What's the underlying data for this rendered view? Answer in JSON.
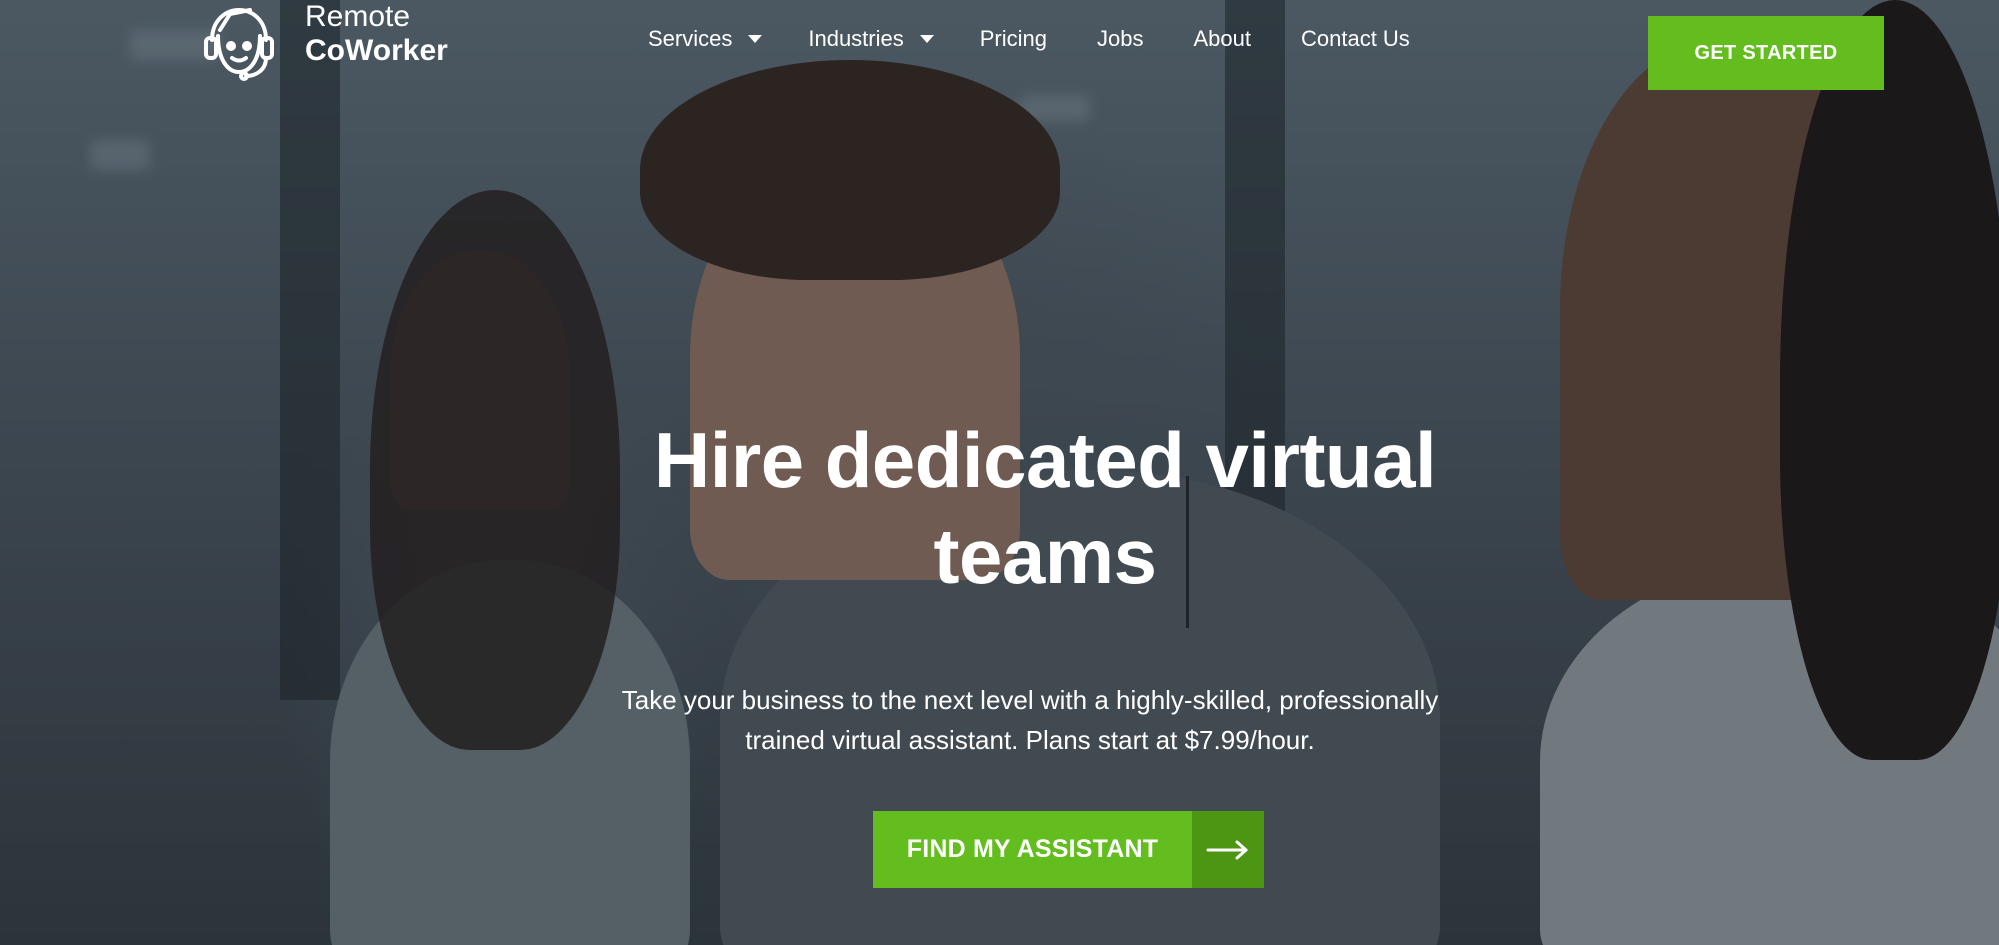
{
  "brand": {
    "line1": "Remote",
    "line2": "CoWorker",
    "logo_icon": "robot-headset-icon"
  },
  "nav": {
    "items": [
      {
        "label": "Services",
        "has_dropdown": true
      },
      {
        "label": "Industries",
        "has_dropdown": true
      },
      {
        "label": "Pricing",
        "has_dropdown": false
      },
      {
        "label": "Jobs",
        "has_dropdown": false
      },
      {
        "label": "About",
        "has_dropdown": false
      },
      {
        "label": "Contact Us",
        "has_dropdown": false
      }
    ]
  },
  "header_cta": {
    "label": "GET STARTED"
  },
  "hero": {
    "title_line1": "Hire dedicated virtual",
    "title_line2": "teams",
    "subtitle_line1": "Take your business to the next level with a highly-skilled, professionally",
    "subtitle_line2": "trained virtual assistant. Plans start at $7.99/hour.",
    "cta_label": "FIND MY ASSISTANT",
    "cta_icon": "arrow-right-icon"
  },
  "colors": {
    "accent": "#63bd1e",
    "accent_dark": "#4d9614",
    "text": "#ffffff"
  }
}
